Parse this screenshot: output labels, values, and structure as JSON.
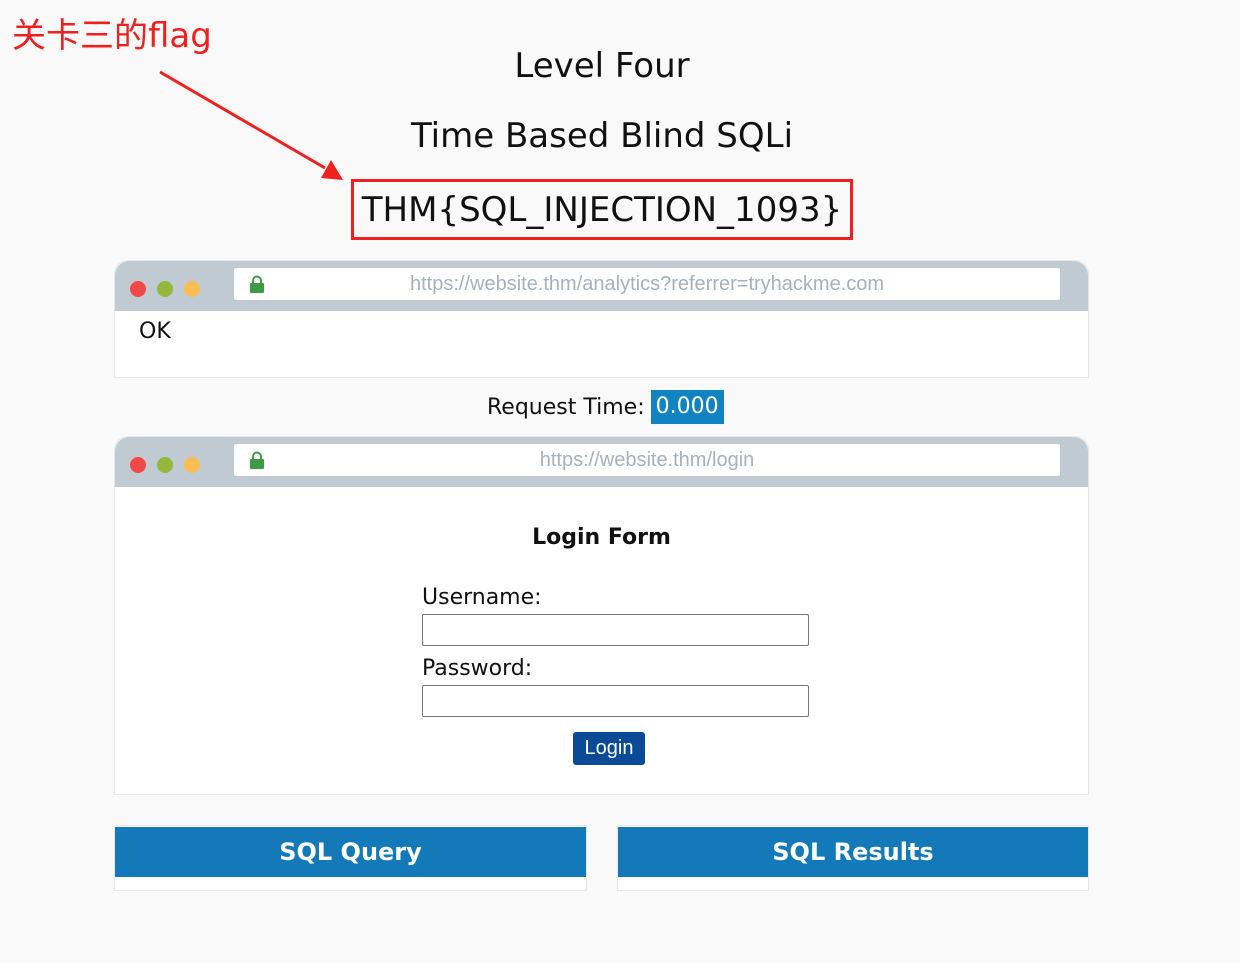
{
  "annotation": {
    "text": "关卡三的flag"
  },
  "level": {
    "title": "Level Four",
    "subtitle": "Time Based Blind SQLi",
    "flag": "THM{SQL_INJECTION_1093}"
  },
  "analytics_browser": {
    "url": "https://website.thm/analytics?referrer=tryhackme.com",
    "response": "OK"
  },
  "request_time": {
    "label": "Request Time:",
    "value": "0.000"
  },
  "login_browser": {
    "url": "https://website.thm/login",
    "form_title": "Login Form",
    "username_label": "Username:",
    "username_value": "",
    "password_label": "Password:",
    "password_value": "",
    "login_label": "Login"
  },
  "panels": {
    "sql_query": "SQL Query",
    "sql_results": "SQL Results"
  },
  "colors": {
    "annotation": "#f0201f",
    "request_time_bg": "#1183c0",
    "login_button": "#0b4a97",
    "panel_header": "#1379b9",
    "browser_bar": "#bfcad3"
  }
}
